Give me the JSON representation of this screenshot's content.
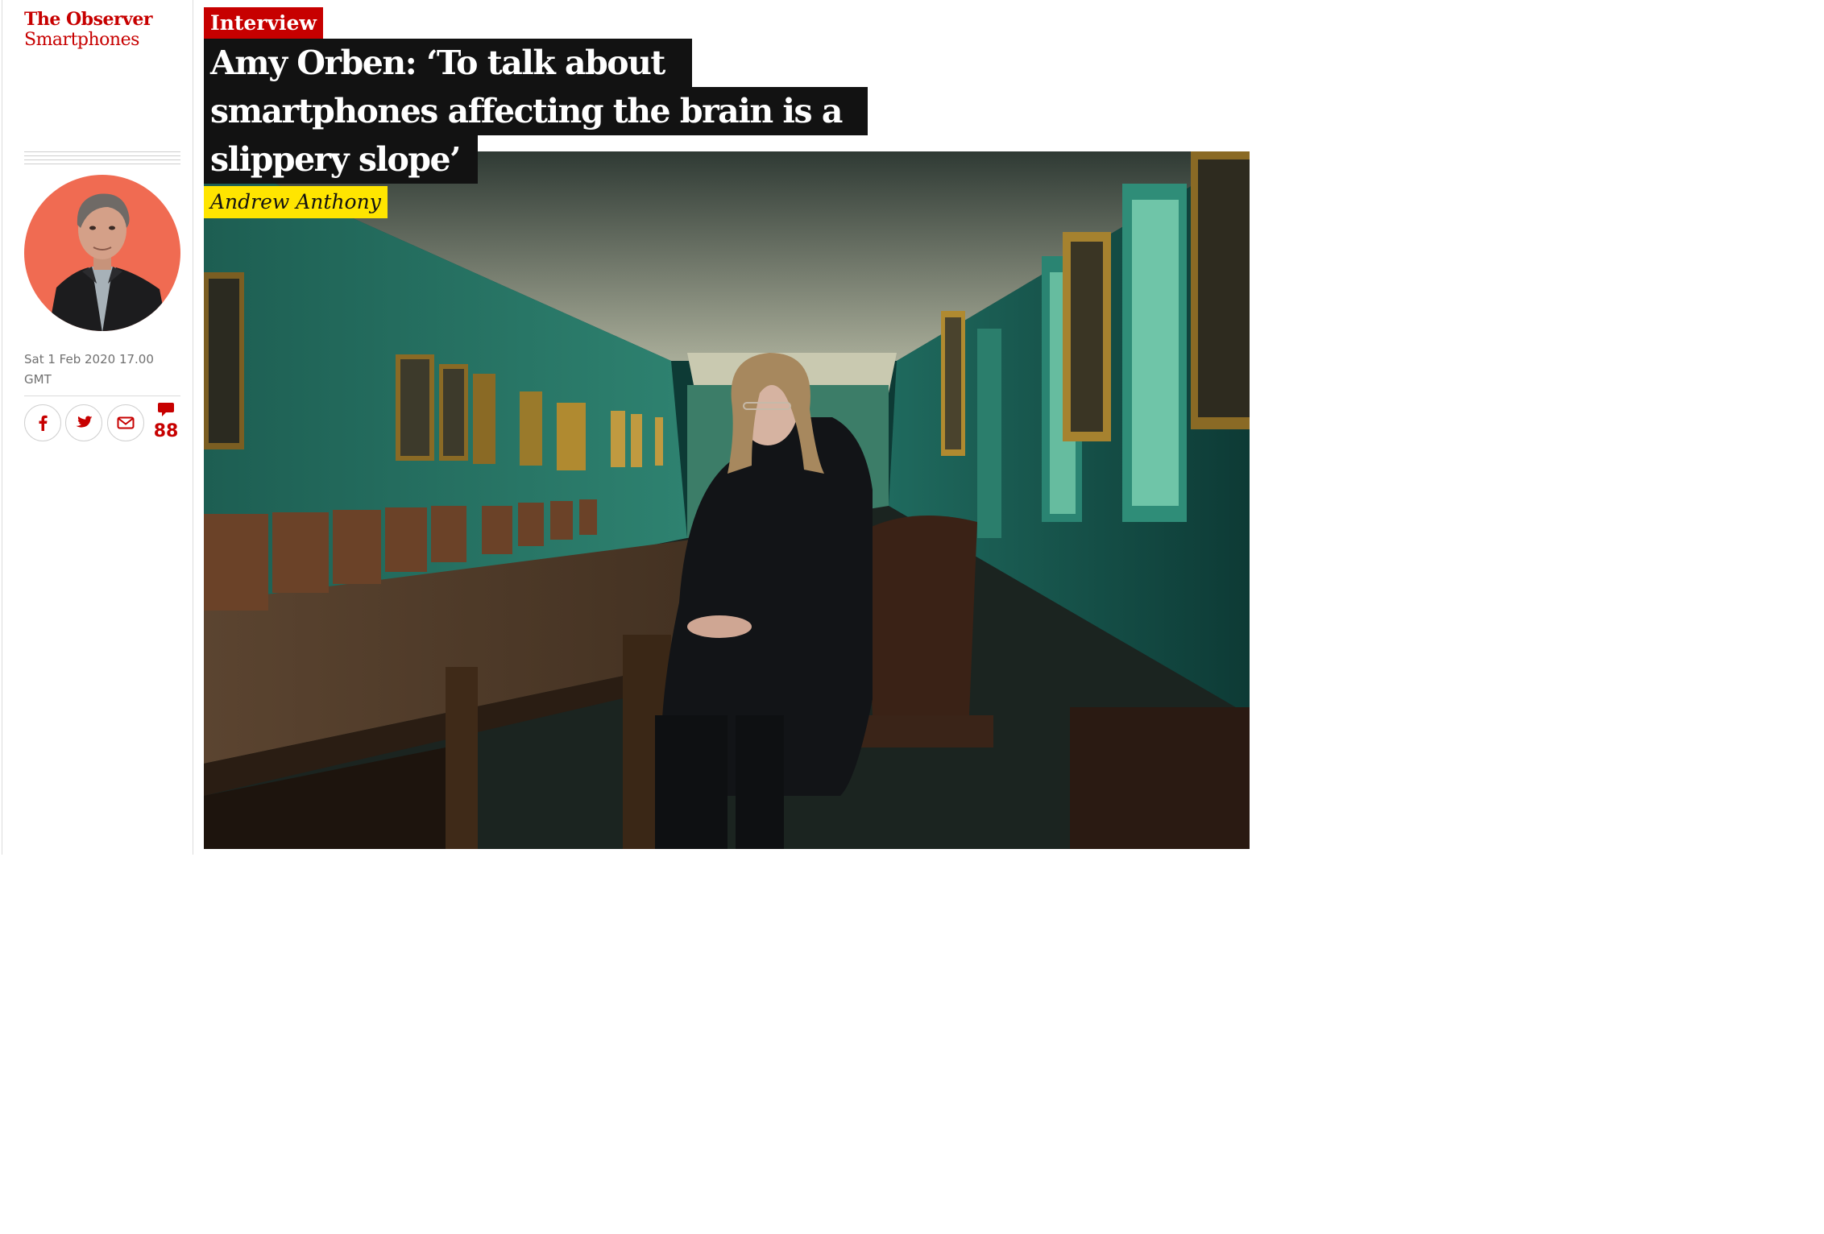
{
  "sidebar": {
    "publication": "The Observer",
    "section": "Smartphones",
    "dateline": "Sat 1 Feb 2020 17.00 GMT",
    "share": [
      {
        "name": "facebook",
        "glyph": "f"
      },
      {
        "name": "twitter",
        "glyph": "twitter-bird-icon"
      },
      {
        "name": "email",
        "glyph": "envelope-icon"
      }
    ],
    "comments_count": "88"
  },
  "article": {
    "kicker": "Interview",
    "headline_lines": [
      "Amy Orben: ‘To talk about",
      "smartphones affecting the brain is a",
      "slippery slope’"
    ],
    "byline": "Andrew Anthony"
  },
  "colors": {
    "brand_red": "#c70000",
    "byline_yellow": "#ffe500",
    "headline_bg": "#121212",
    "avatar_bg": "#f06b52"
  }
}
